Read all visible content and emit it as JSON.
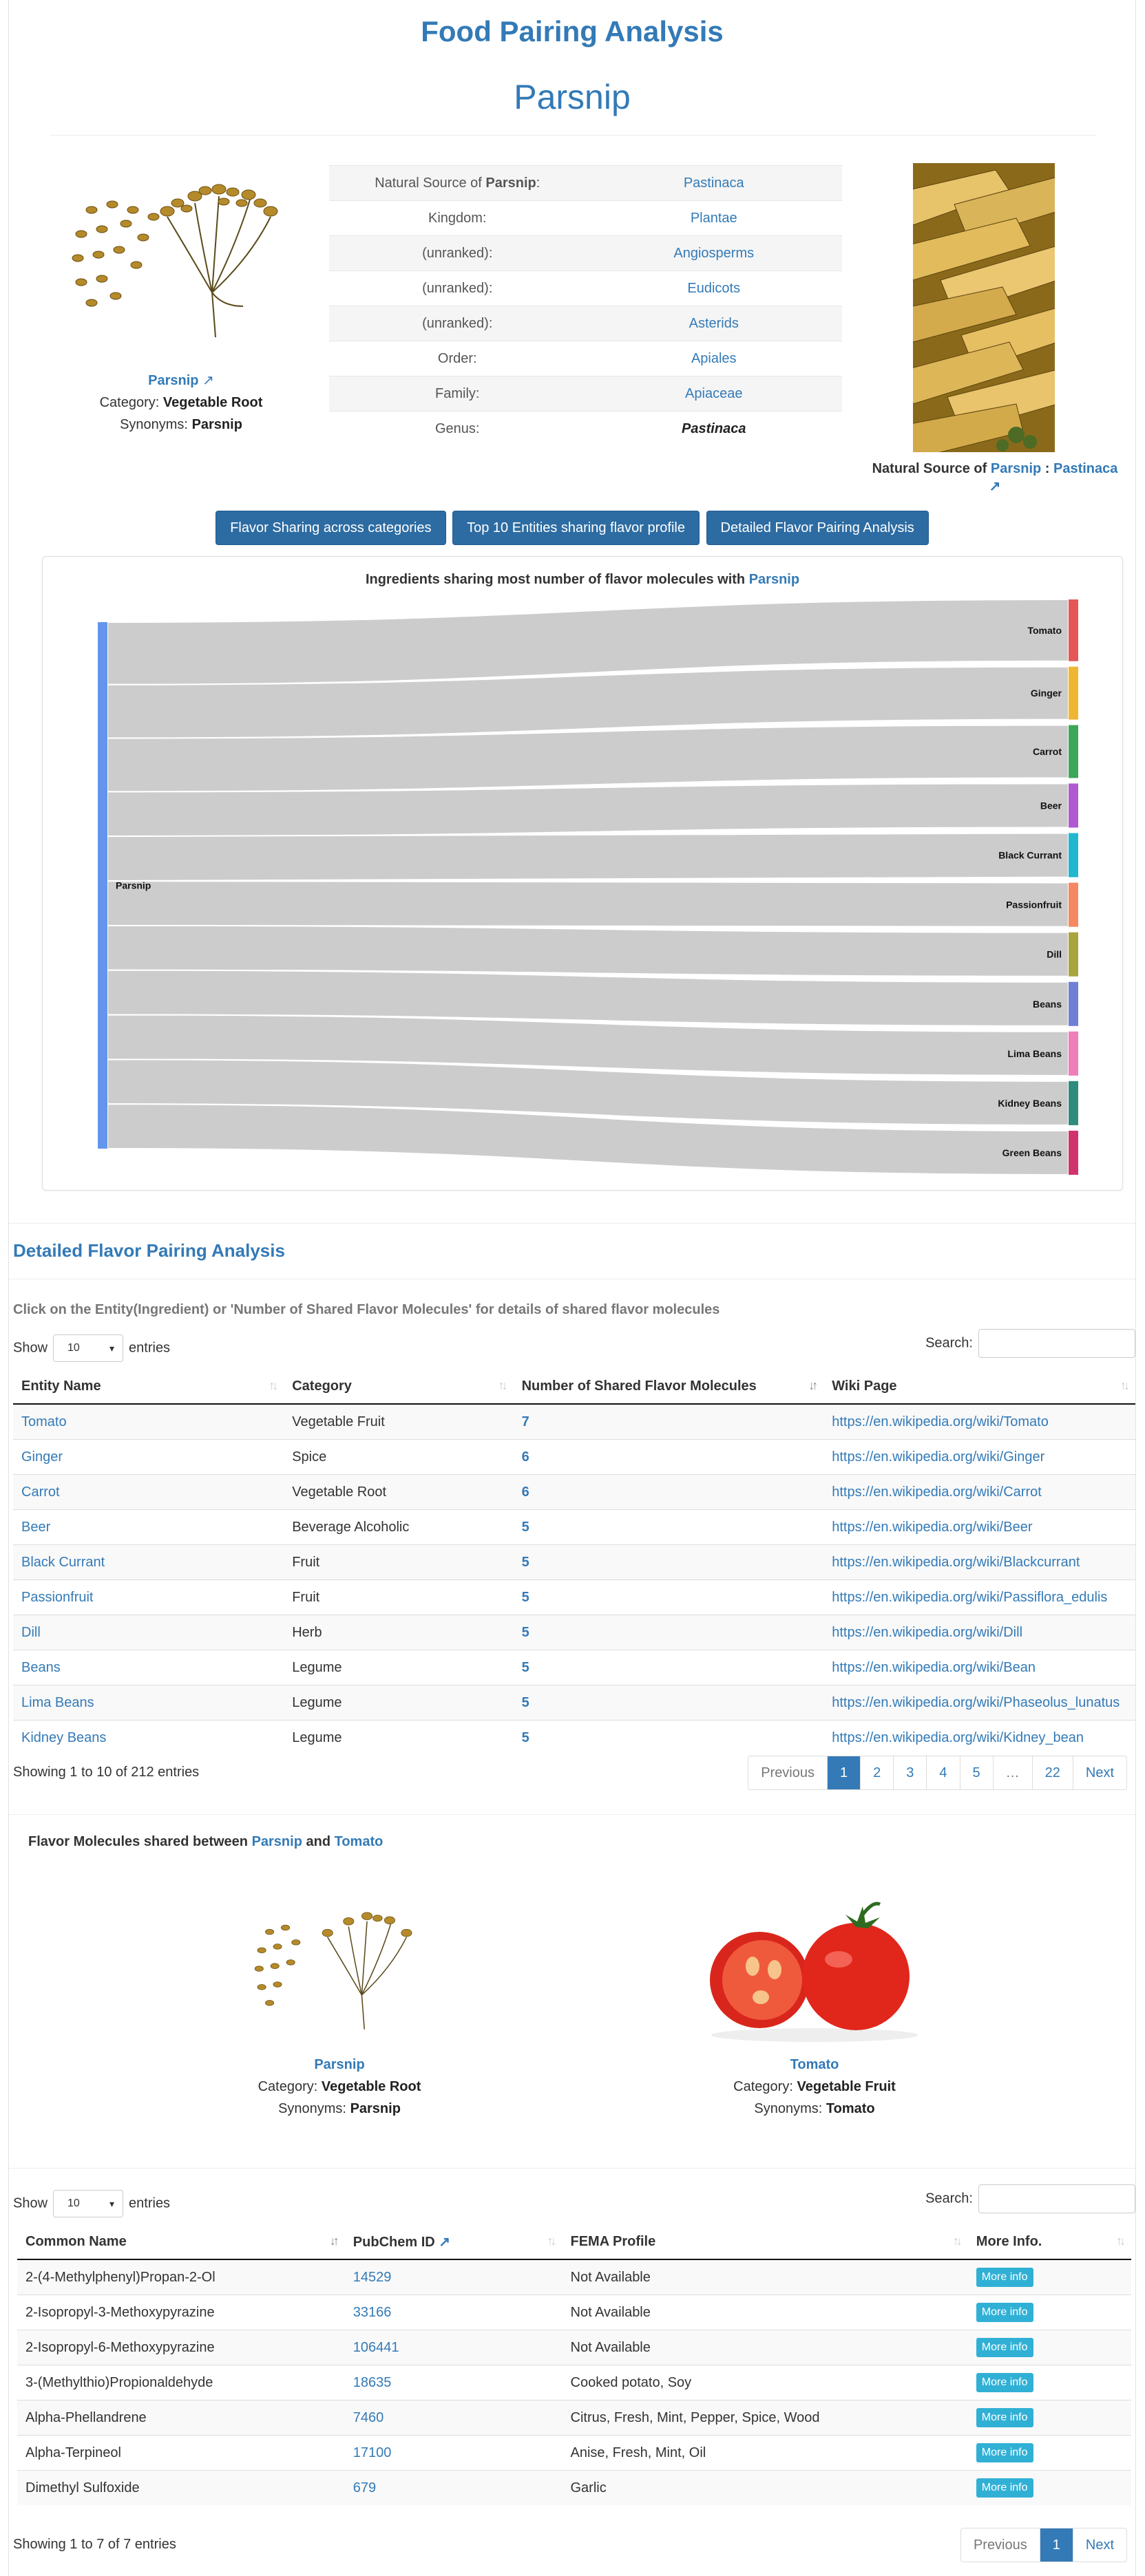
{
  "page": {
    "title": "Food Pairing Analysis",
    "entity_name": "Parsnip"
  },
  "entity": {
    "name": "Parsnip",
    "category_label": "Category:",
    "category": "Vegetable Root",
    "synonyms_label": "Synonyms:",
    "synonyms": "Parsnip"
  },
  "taxonomy": [
    {
      "label_prefix": "Natural Source of ",
      "label_bold": "Parsnip",
      "label_suffix": ":",
      "value": "Pastinaca",
      "link": true
    },
    {
      "label_prefix": "Kingdom:",
      "label_bold": "",
      "label_suffix": "",
      "value": "Plantae",
      "link": true
    },
    {
      "label_prefix": "(unranked):",
      "label_bold": "",
      "label_suffix": "",
      "value": "Angiosperms",
      "link": true
    },
    {
      "label_prefix": "(unranked):",
      "label_bold": "",
      "label_suffix": "",
      "value": "Eudicots",
      "link": true
    },
    {
      "label_prefix": "(unranked):",
      "label_bold": "",
      "label_suffix": "",
      "value": "Asterids",
      "link": true
    },
    {
      "label_prefix": "Order:",
      "label_bold": "",
      "label_suffix": "",
      "value": "Apiales",
      "link": true
    },
    {
      "label_prefix": "Family:",
      "label_bold": "",
      "label_suffix": "",
      "value": "Apiaceae",
      "link": true
    },
    {
      "label_prefix": "Genus:",
      "label_bold": "",
      "label_suffix": "",
      "value": "Pastinaca",
      "link": false
    }
  ],
  "natural_source": {
    "prefix": "Natural Source of ",
    "entity": "Parsnip",
    "sep": " : ",
    "source": "Pastinaca"
  },
  "buttons": {
    "flavor_sharing": "Flavor Sharing across categories",
    "top10": "Top 10 Entities sharing flavor profile",
    "detailed": "Detailed Flavor Pairing Analysis"
  },
  "sankey": {
    "title_prefix": "Ingredients sharing most number of flavor molecules with ",
    "title_entity": "Parsnip",
    "source_color": "#6495ed",
    "link_color": "#cccccc"
  },
  "chart_data": {
    "type": "sankey",
    "source": "Parsnip",
    "targets": [
      {
        "name": "Tomato",
        "value": 7,
        "color": "#e45756"
      },
      {
        "name": "Ginger",
        "value": 6,
        "color": "#f1b631"
      },
      {
        "name": "Carrot",
        "value": 6,
        "color": "#3ca65a"
      },
      {
        "name": "Beer",
        "value": 5,
        "color": "#b05ad0"
      },
      {
        "name": "Black Currant",
        "value": 5,
        "color": "#20b7cf"
      },
      {
        "name": "Passionfruit",
        "value": 5,
        "color": "#f58862"
      },
      {
        "name": "Dill",
        "value": 5,
        "color": "#a8a53c"
      },
      {
        "name": "Beans",
        "value": 5,
        "color": "#6f7fd4"
      },
      {
        "name": "Lima Beans",
        "value": 5,
        "color": "#ee7fb8"
      },
      {
        "name": "Kidney Beans",
        "value": 5,
        "color": "#2f8c7c"
      },
      {
        "name": "Green Beans",
        "value": 5,
        "color": "#d1346d"
      }
    ]
  },
  "detailed": {
    "title": "Detailed Flavor Pairing Analysis",
    "hint": "Click on the Entity(Ingredient) or 'Number of Shared Flavor Molecules' for details of shared flavor molecules",
    "show_label": "Show",
    "entries_value": "10",
    "entries_label": "entries",
    "search_label": "Search:",
    "columns": [
      "Entity Name",
      "Category",
      "Number of Shared Flavor Molecules",
      "Wiki Page"
    ],
    "rows": [
      [
        "Tomato",
        "Vegetable Fruit",
        "7",
        "https://en.wikipedia.org/wiki/Tomato"
      ],
      [
        "Ginger",
        "Spice",
        "6",
        "https://en.wikipedia.org/wiki/Ginger"
      ],
      [
        "Carrot",
        "Vegetable Root",
        "6",
        "https://en.wikipedia.org/wiki/Carrot"
      ],
      [
        "Beer",
        "Beverage Alcoholic",
        "5",
        "https://en.wikipedia.org/wiki/Beer"
      ],
      [
        "Black Currant",
        "Fruit",
        "5",
        "https://en.wikipedia.org/wiki/Blackcurrant"
      ],
      [
        "Passionfruit",
        "Fruit",
        "5",
        "https://en.wikipedia.org/wiki/Passiflora_edulis"
      ],
      [
        "Dill",
        "Herb",
        "5",
        "https://en.wikipedia.org/wiki/Dill"
      ],
      [
        "Beans",
        "Legume",
        "5",
        "https://en.wikipedia.org/wiki/Bean"
      ],
      [
        "Lima Beans",
        "Legume",
        "5",
        "https://en.wikipedia.org/wiki/Phaseolus_lunatus"
      ],
      [
        "Kidney Beans",
        "Legume",
        "5",
        "https://en.wikipedia.org/wiki/Kidney_bean"
      ]
    ],
    "info": "Showing 1 to 10 of 212 entries",
    "pager": [
      "Previous",
      "1",
      "2",
      "3",
      "4",
      "5",
      "…",
      "22",
      "Next"
    ]
  },
  "pair": {
    "title_prefix": "Flavor Molecules shared between ",
    "entity_a": "Parsnip",
    "and": " and ",
    "entity_b": "Tomato",
    "a": {
      "name": "Parsnip",
      "category": "Vegetable Root",
      "synonyms": "Parsnip"
    },
    "b": {
      "name": "Tomato",
      "category": "Vegetable Fruit",
      "synonyms": "Tomato"
    }
  },
  "molecules": {
    "show_label": "Show",
    "entries_value": "10",
    "entries_label": "entries",
    "search_label": "Search:",
    "columns": [
      "Common Name",
      "PubChem ID",
      "FEMA Profile",
      "More Info."
    ],
    "more_label": "More info",
    "rows": [
      [
        "2-(4-Methylphenyl)Propan-2-Ol",
        "14529",
        "Not Available"
      ],
      [
        "2-Isopropyl-3-Methoxypyrazine",
        "33166",
        "Not Available"
      ],
      [
        "2-Isopropyl-6-Methoxypyrazine",
        "106441",
        "Not Available"
      ],
      [
        "3-(Methylthio)Propionaldehyde",
        "18635",
        "Cooked potato, Soy"
      ],
      [
        "Alpha-Phellandrene",
        "7460",
        "Citrus, Fresh, Mint, Pepper, Spice, Wood"
      ],
      [
        "Alpha-Terpineol",
        "17100",
        "Anise, Fresh, Mint, Oil"
      ],
      [
        "Dimethyl Sulfoxide",
        "679",
        "Garlic"
      ]
    ],
    "info": "Showing 1 to 7 of 7 entries",
    "pager": [
      "Previous",
      "1",
      "Next"
    ]
  }
}
